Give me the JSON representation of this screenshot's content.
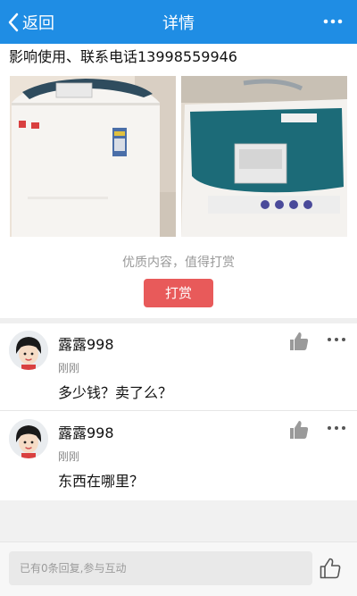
{
  "header": {
    "back_label": "返回",
    "title": "详情"
  },
  "post": {
    "text": "影响使用、联系电话13998559946",
    "reward_hint": "优质内容，值得打赏",
    "reward_button": "打赏"
  },
  "comments": [
    {
      "name": "露露998",
      "time": "刚刚",
      "text": "多少钱？卖了么？"
    },
    {
      "name": "露露998",
      "time": "刚刚",
      "text": "东西在哪里？"
    }
  ],
  "footer": {
    "input_placeholder": "已有0条回复,参与互动"
  },
  "colors": {
    "header_bg": "#1f8de4",
    "reward_button_bg": "#e85a5a"
  },
  "icons": [
    "back-chevron-icon",
    "more-icon",
    "thumbs-up-icon"
  ]
}
